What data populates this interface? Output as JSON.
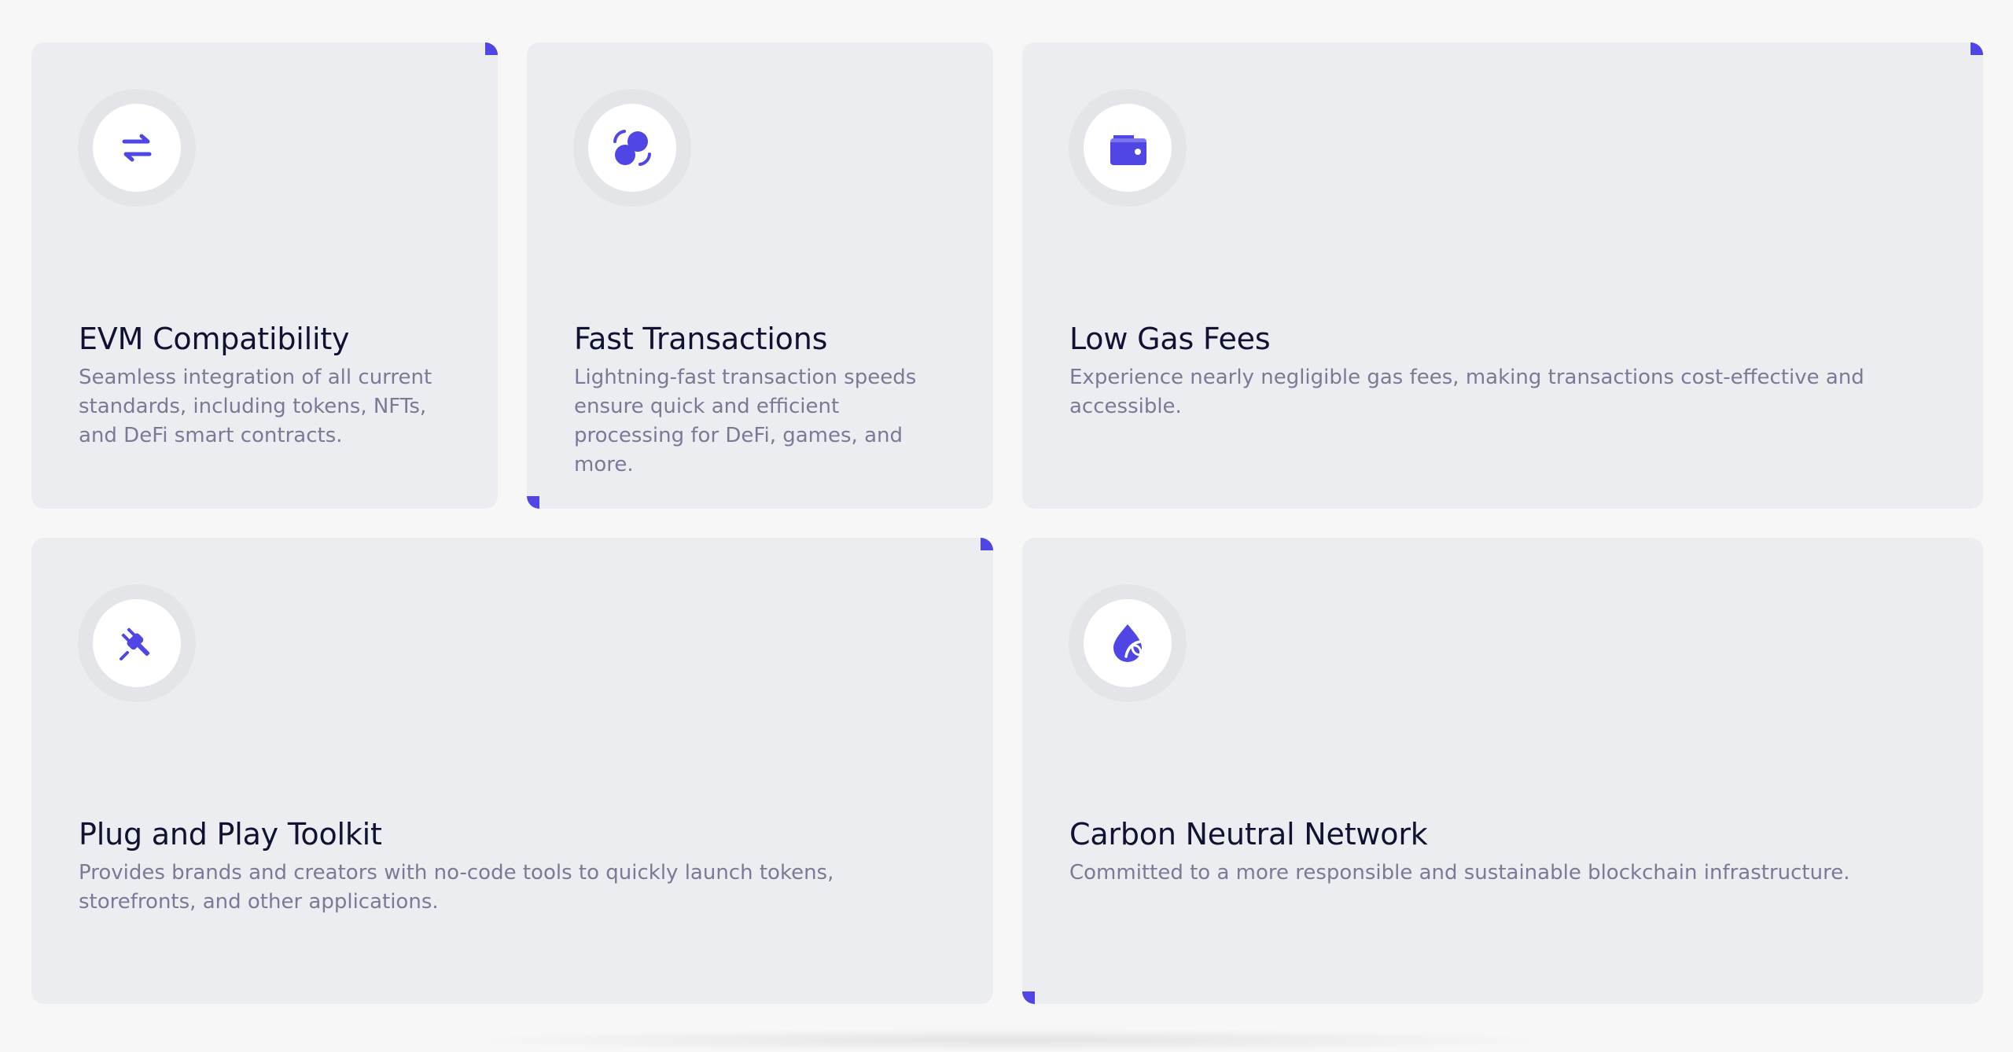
{
  "accent_color": "#4f46e5",
  "cards": [
    {
      "icon": "swap-arrows-icon",
      "title": "EVM Compatibility",
      "description": "Seamless integration of all current standards, including tokens, NFTs, and DeFi smart contracts."
    },
    {
      "icon": "transaction-circles-icon",
      "title": "Fast Transactions",
      "description": "Lightning-fast transaction speeds ensure quick and efficient processing for DeFi, games, and more."
    },
    {
      "icon": "wallet-icon",
      "title": "Low Gas Fees",
      "description": "Experience nearly negligible gas fees, making transactions cost-effective and accessible."
    },
    {
      "icon": "plug-icon",
      "title": "Plug and Play Toolkit",
      "description": "Provides brands and creators with no-code tools to quickly launch tokens, storefronts, and other applications."
    },
    {
      "icon": "leaf-drop-icon",
      "title": "Carbon Neutral Network",
      "description": "Committed to a more responsible and sustainable blockchain infrastructure."
    }
  ]
}
